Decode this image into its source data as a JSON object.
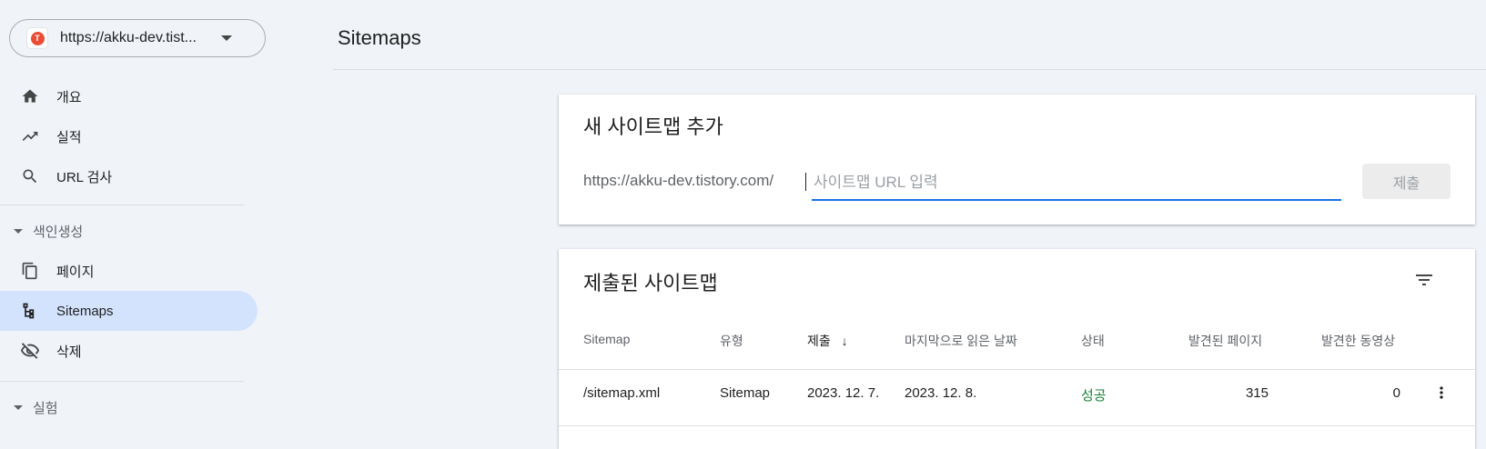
{
  "property": {
    "url": "https://akku-dev.tist...",
    "favicon_letter": "T"
  },
  "sidebar": {
    "items": [
      {
        "label": "개요",
        "icon": "home-icon"
      },
      {
        "label": "실적",
        "icon": "trending-up-icon"
      },
      {
        "label": "URL 검사",
        "icon": "search-icon"
      }
    ],
    "sections": [
      {
        "label": "색인생성"
      },
      {
        "label": "실험"
      }
    ],
    "index_items": [
      {
        "label": "페이지",
        "icon": "pages-icon"
      },
      {
        "label": "Sitemaps",
        "icon": "sitemap-icon",
        "active": true
      },
      {
        "label": "삭제",
        "icon": "visibility-off-icon"
      }
    ]
  },
  "header": {
    "title": "Sitemaps"
  },
  "add_card": {
    "title": "새 사이트맵 추가",
    "prefix": "https://akku-dev.tistory.com/",
    "placeholder": "사이트맵 URL 입력",
    "value": "",
    "submit_label": "제출"
  },
  "list_card": {
    "title": "제출된 사이트맵",
    "columns": [
      "Sitemap",
      "유형",
      "제출",
      "마지막으로 읽은 날짜",
      "상태",
      "발견된 페이지",
      "발견한 동영상"
    ],
    "sort_indicator": "↓",
    "rows": [
      {
        "sitemap": "/sitemap.xml",
        "type": "Sitemap",
        "submitted": "2023. 12. 7.",
        "last_read": "2023. 12. 8.",
        "status": "성공",
        "pages": "315",
        "videos": "0"
      }
    ]
  },
  "colors": {
    "accent": "#1a73e8",
    "active_nav": "#d3e3fd",
    "success": "#188038",
    "background": "#f0f4f9"
  }
}
